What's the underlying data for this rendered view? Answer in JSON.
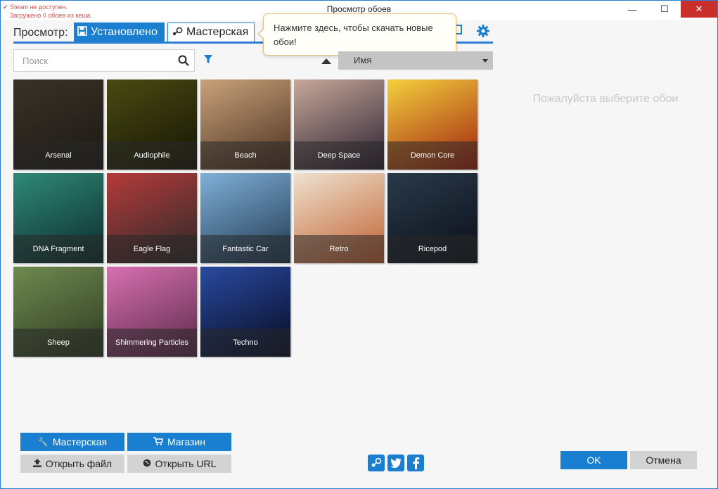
{
  "window": {
    "title": "Просмотр обоев",
    "status_line1": "Steam не доступен.",
    "status_line2": "Загружено 0 обоев из кеша."
  },
  "toolbar": {
    "view_label": "Просмотр:",
    "tab_installed": "Установлено",
    "tab_workshop": "Мастерская"
  },
  "tooltip": {
    "text": "Нажмите здесь, чтобы скачать новые обои!"
  },
  "search": {
    "placeholder": "Поиск",
    "value": ""
  },
  "sort": {
    "field": "Имя",
    "direction": "ascending"
  },
  "wallpapers": [
    {
      "title": "Arsenal",
      "c1": "#3a3228",
      "c2": "#1c1814"
    },
    {
      "title": "Audiophile",
      "c1": "#4a4a12",
      "c2": "#151505"
    },
    {
      "title": "Beach",
      "c1": "#c9a27a",
      "c2": "#4a3020"
    },
    {
      "title": "Deep Space",
      "c1": "#c7a89a",
      "c2": "#2a2030"
    },
    {
      "title": "Demon Core",
      "c1": "#f4d03c",
      "c2": "#a02010"
    },
    {
      "title": "DNA Fragment",
      "c1": "#2f8a78",
      "c2": "#0c2a2a"
    },
    {
      "title": "Eagle Flag",
      "c1": "#b63a3a",
      "c2": "#2a2a2a"
    },
    {
      "title": "Fantastic Car",
      "c1": "#7fb0d8",
      "c2": "#203850"
    },
    {
      "title": "Retro",
      "c1": "#efe2cf",
      "c2": "#c06030"
    },
    {
      "title": "Ricepod",
      "c1": "#2a3a4a",
      "c2": "#0a0f18"
    },
    {
      "title": "Sheep",
      "c1": "#6f8a4f",
      "c2": "#2e3a22"
    },
    {
      "title": "Shimmering Particles",
      "c1": "#d870b0",
      "c2": "#5a2a4a"
    },
    {
      "title": "Techno",
      "c1": "#2a4aa0",
      "c2": "#050a20"
    }
  ],
  "detail_placeholder": "Пожалуйста выберите обои",
  "bottom": {
    "workshop_button": "Мастерская",
    "store_button": "Магазин",
    "open_file_button": "Открыть файл",
    "open_url_button": "Открыть URL",
    "ok_button": "OK",
    "cancel_button": "Отмена"
  },
  "colors": {
    "accent": "#1a7fd0",
    "error": "#d9534f",
    "tooltip_border": "#e7c07a"
  }
}
